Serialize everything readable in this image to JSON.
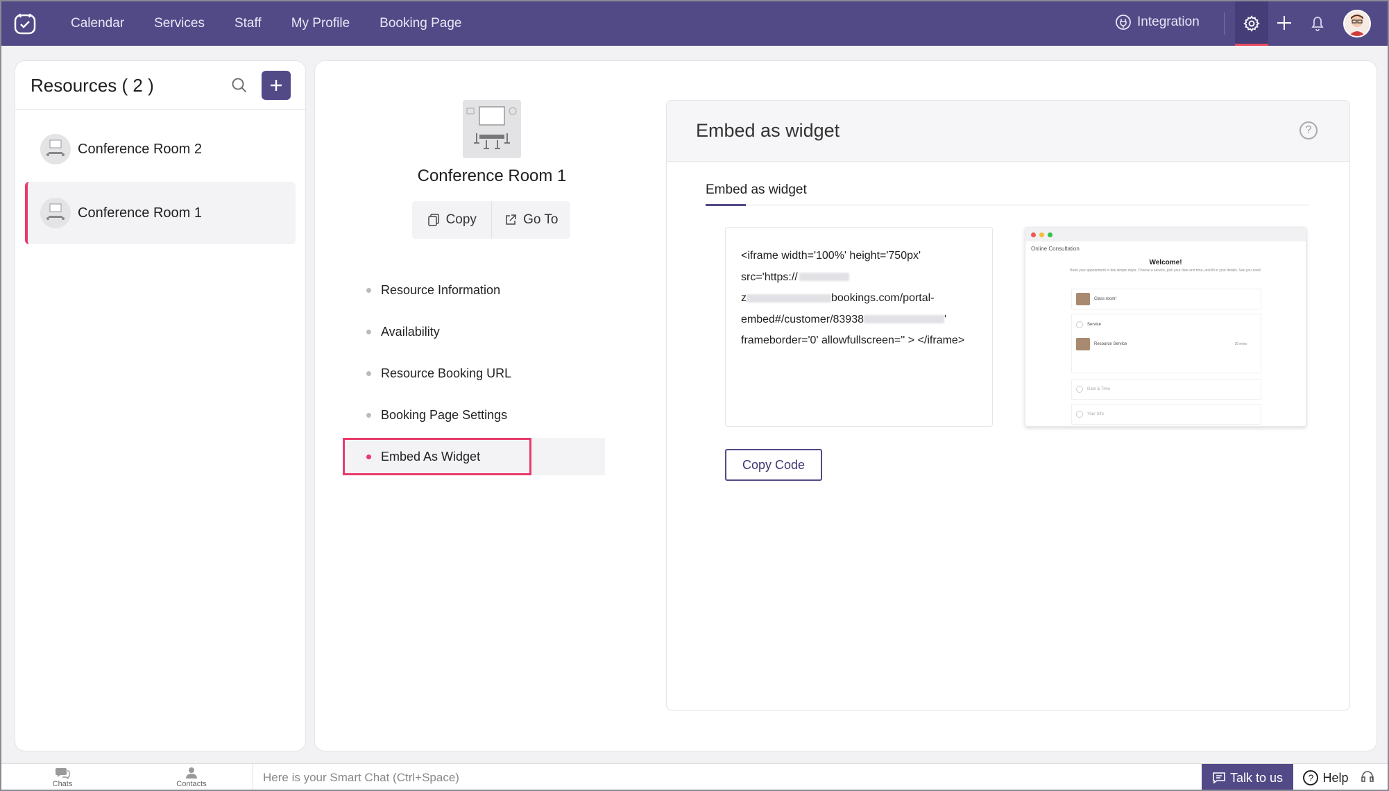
{
  "nav": {
    "links": [
      "Calendar",
      "Services",
      "Staff",
      "My Profile",
      "Booking Page"
    ],
    "integration": "Integration"
  },
  "resources": {
    "title": "Resources ( 2 )",
    "items": [
      {
        "name": "Conference Room 2",
        "active": false
      },
      {
        "name": "Conference Room 1",
        "active": true
      }
    ]
  },
  "detail": {
    "room_title": "Conference Room 1",
    "copy_label": "Copy",
    "goto_label": "Go To",
    "menu": [
      "Resource Information",
      "Availability",
      "Resource Booking URL",
      "Booking Page Settings",
      "Embed As Widget"
    ],
    "active_menu_index": 4
  },
  "embed": {
    "header": "Embed as widget",
    "tab": "Embed as widget",
    "code_lines": [
      "<iframe width='100%' height='750px'",
      "src='https://",
      "bookings.com/portal-",
      "embed#/customer/83938",
      "frameborder='0' allowfullscreen='' > </iframe>"
    ],
    "code_line3_prefix": "z",
    "code_line4_suffix": "'",
    "copy_code": "Copy Code",
    "preview": {
      "header": "Online Consultation",
      "welcome": "Welcome!",
      "subtitle": "Book your appointment in few simple steps. Choose a service, pick your date and time, and fill in your details. See you soon!",
      "rows": [
        "Class room!",
        "Service",
        "Resource Service",
        "Date & Time",
        "Your Info"
      ],
      "row_sub": "Resource service",
      "row_right": "30 mins"
    }
  },
  "bottom": {
    "chats": "Chats",
    "contacts": "Contacts",
    "smart_chat": "Here is your Smart Chat (Ctrl+Space)",
    "talk": "Talk to us",
    "help": "Help"
  },
  "colors": {
    "brand": "#524a87",
    "accent": "#e8396b"
  }
}
